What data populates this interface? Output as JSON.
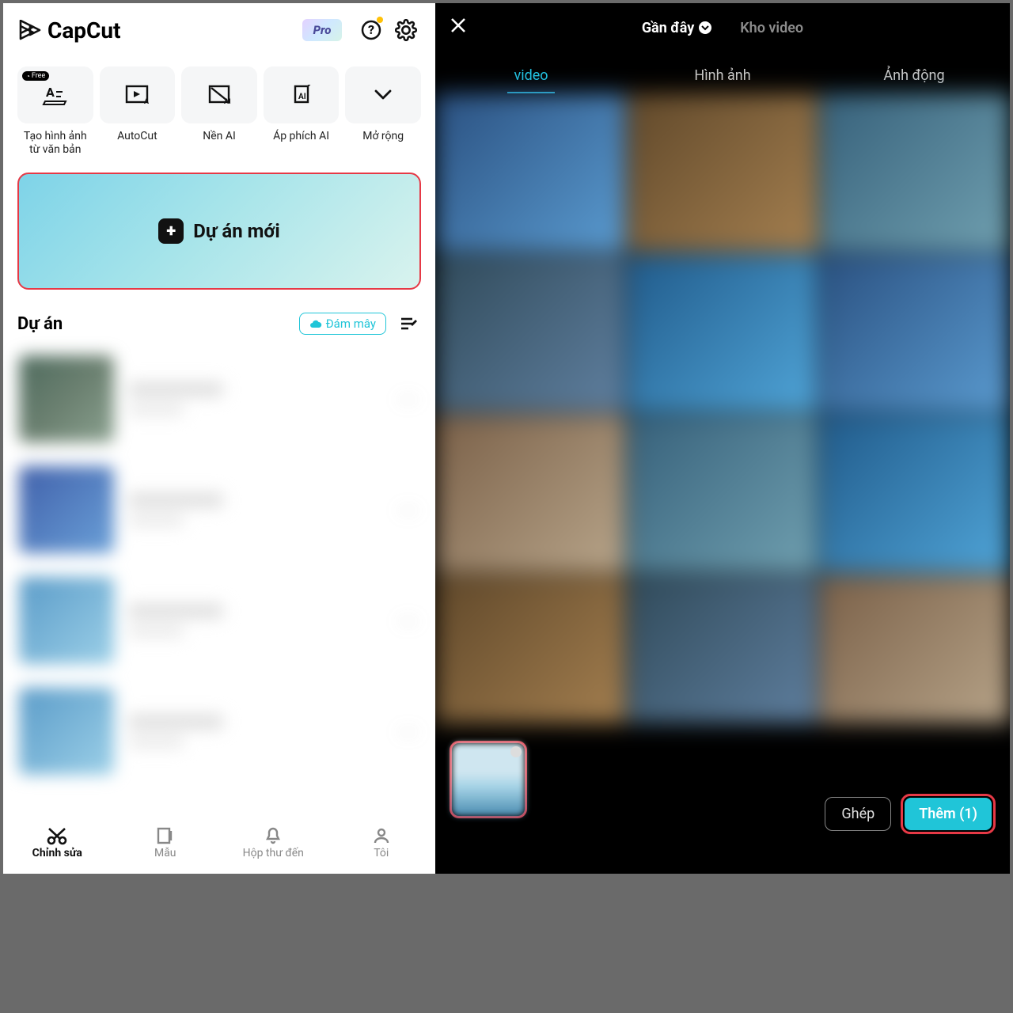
{
  "left": {
    "brand": "CapCut",
    "pro_badge": "Pro",
    "tools": [
      {
        "label": "Tạo hình ảnh từ văn bản",
        "free_tag": "Free"
      },
      {
        "label": "AutoCut"
      },
      {
        "label": "Nền AI"
      },
      {
        "label": "Áp phích AI"
      },
      {
        "label": "Mở rộng"
      }
    ],
    "new_project": "Dự án mới",
    "projects_title": "Dự án",
    "cloud_btn": "Đám mây",
    "nav": {
      "edit": "Chỉnh sửa",
      "templates": "Mẫu",
      "inbox": "Hộp thư đến",
      "me": "Tôi"
    }
  },
  "right": {
    "recent": "Gần đây",
    "stock": "Kho video",
    "tabs": {
      "video": "video",
      "image": "Hình ảnh",
      "gif": "Ảnh động"
    },
    "join": "Ghép",
    "add": "Thêm (1)"
  }
}
